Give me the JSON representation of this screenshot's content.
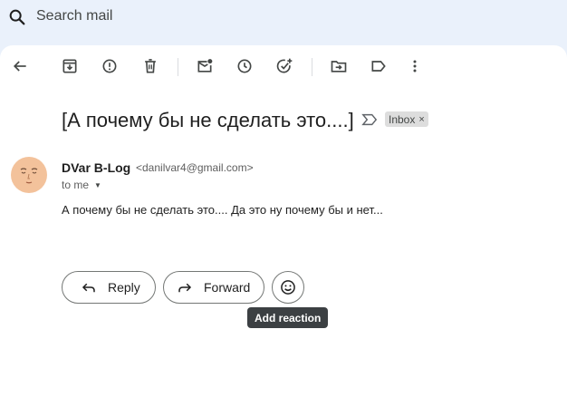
{
  "search": {
    "placeholder": "Search mail"
  },
  "toolbar": {
    "back": "back-arrow-icon",
    "actions": [
      "archive-icon",
      "report-spam-icon",
      "delete-icon",
      "mark-unread-icon",
      "snooze-icon",
      "add-task-icon",
      "move-to-icon",
      "label-icon",
      "more-icon"
    ]
  },
  "message": {
    "subject": "[А почему бы не сделать это....]",
    "label": "Inbox",
    "label_remove": "×",
    "sender_name": "DVar B-Log",
    "sender_email": "<danilvar4@gmail.com>",
    "recipient": "to me",
    "body": "А почему бы не сделать это.... Да это ну почему бы и нет..."
  },
  "actions": {
    "reply_label": "Reply",
    "forward_label": "Forward",
    "reaction_tooltip": "Add reaction"
  },
  "colors": {
    "background": "#eaf1fb",
    "panel": "#ffffff",
    "avatar": "#f3c29b",
    "chip": "#dddddd",
    "tooltip": "#3c4043"
  }
}
